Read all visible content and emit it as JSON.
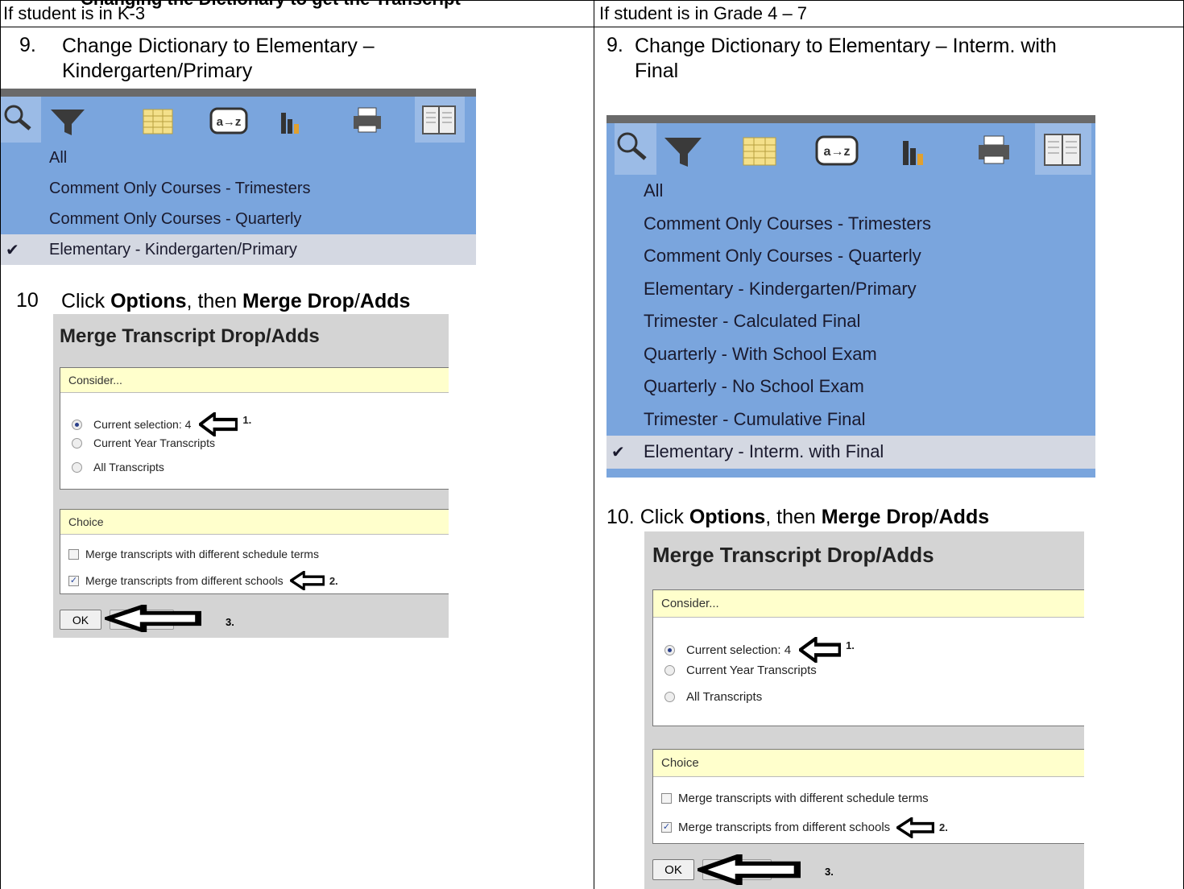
{
  "header": {
    "cutoff_title": "Changing the Dictionary to get the Transcript",
    "left_heading": "If student is in K-3",
    "right_heading": "If student is in Grade 4 – 7"
  },
  "left": {
    "step9_num": "9.",
    "step9_line1": "Change Dictionary to Elementary –",
    "step9_line2": "Kindergarten/Primary",
    "menu": [
      "All",
      "Comment Only Courses - Trimesters",
      "Comment Only Courses - Quarterly",
      "Elementary - Kindergarten/Primary"
    ],
    "selected_index": 3,
    "step10_num": "10",
    "step10_pre": "Click ",
    "step10_b1": "Options",
    "step10_mid": ", then ",
    "step10_b2": "Merge Drop",
    "step10_slash": "/",
    "step10_b3": "Adds"
  },
  "right": {
    "step9_num": "9.",
    "step9_line1": "Change Dictionary to Elementary – Interm. with",
    "step9_line2": "Final",
    "menu": [
      "All",
      "Comment Only Courses - Trimesters",
      "Comment Only Courses - Quarterly",
      "Elementary - Kindergarten/Primary",
      "Trimester - Calculated Final",
      "Quarterly - With School Exam",
      "Quarterly - No School Exam",
      "Trimester - Cumulative Final",
      "Elementary - Interm. with Final"
    ],
    "selected_index": 8,
    "step10_num": "10.",
    "step10_pre": "Click ",
    "step10_b1": "Options",
    "step10_mid": ", then ",
    "step10_b2": "Merge Drop",
    "step10_slash": "/",
    "step10_b3": "Adds"
  },
  "dialog": {
    "title": "Merge Transcript Drop/Adds",
    "consider_label": "Consider...",
    "options": [
      "Current selection: 4",
      "Current Year Transcripts",
      "All Transcripts"
    ],
    "selected_option": 0,
    "choice_label": "Choice",
    "checkboxes": [
      {
        "label": "Merge transcripts with different schedule terms",
        "checked": false
      },
      {
        "label": "Merge transcripts from different schools",
        "checked": true
      }
    ],
    "ok_label": "OK",
    "annotations": [
      "1.",
      "2.",
      "3."
    ]
  },
  "colors": {
    "menu_blue": "#7aa5dd",
    "selected_row": "#d4d8e2",
    "section_header": "#ffffcc",
    "dialog_bg": "#d4d4d4"
  }
}
